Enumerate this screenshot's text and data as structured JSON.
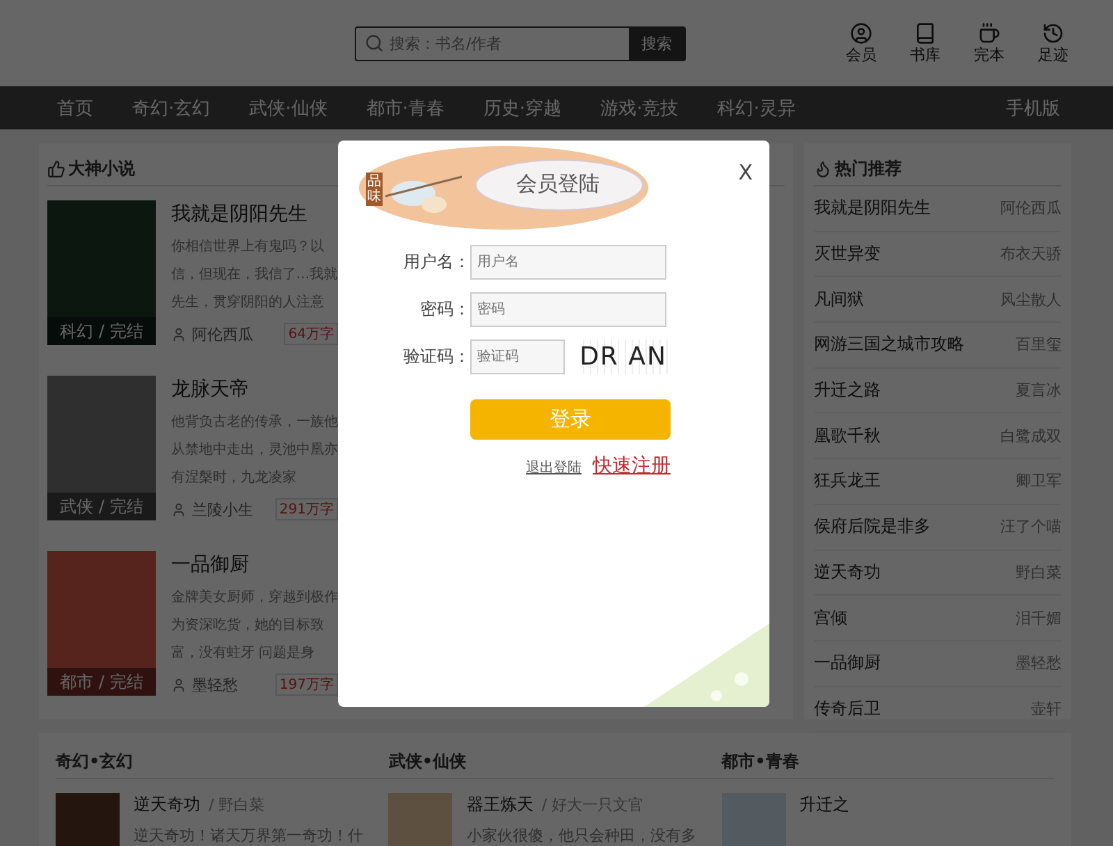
{
  "header": {
    "search": {
      "placeholder": "搜索：书名/作者",
      "button": "搜索"
    },
    "user_links": [
      {
        "kind": "member",
        "label": "会员"
      },
      {
        "kind": "library",
        "label": "书库"
      },
      {
        "kind": "finished",
        "label": "完本"
      },
      {
        "kind": "history",
        "label": "足迹"
      }
    ]
  },
  "nav": {
    "items": [
      "首页",
      "奇幻·玄幻",
      "武侠·仙侠",
      "都市·青春",
      "历史·穿越",
      "游戏·竞技",
      "科幻·灵异"
    ],
    "mobile": "手机版"
  },
  "featured": {
    "title": "大神小说",
    "books": [
      {
        "title": "我就是阴阳先生",
        "description": "你相信世界上有鬼吗？以信，但现在，我信了...我就先生，贯穿阴阳的人注意",
        "caption": "科幻 / 完结",
        "author": "阿伦西瓜",
        "words": "64万字"
      },
      {
        "title": "龙脉天帝",
        "description": "他背负古老的传承，一族他从禁地中走出，灵池中凰亦有涅槃时，九龙凌家",
        "caption": "武侠 / 完结",
        "author": "兰陵小生",
        "words": "291万字"
      },
      {
        "title": "一品御厨",
        "description": "金牌美女厨师，穿越到极作为资深吃货，她的目标致富，没有蛀牙 问题是身",
        "caption": "都市 / 完结",
        "author": "墨轻愁",
        "words": "197万字"
      }
    ]
  },
  "hot": {
    "title": "热门推荐",
    "items": [
      {
        "title": "我就是阴阳先生",
        "author": "阿伦西瓜"
      },
      {
        "title": "灭世异变",
        "author": "布衣天骄"
      },
      {
        "title": "凡间狱",
        "author": "风尘散人"
      },
      {
        "title": "网游三国之城市攻略",
        "author": "百里玺"
      },
      {
        "title": "升迁之路",
        "author": "夏言冰"
      },
      {
        "title": "凰歌千秋",
        "author": "白鹭成双"
      },
      {
        "title": "狂兵龙王",
        "author": "卿卫军"
      },
      {
        "title": "侯府后院是非多",
        "author": "汪了个喵"
      },
      {
        "title": "逆天奇功",
        "author": "野白菜"
      },
      {
        "title": "宫倾",
        "author": "泪千媚"
      },
      {
        "title": "一品御厨",
        "author": "墨轻愁"
      },
      {
        "title": "传奇后卫",
        "author": "壶轩"
      }
    ]
  },
  "categories": [
    {
      "title": "奇幻•玄幻",
      "book": {
        "title": "逆天奇功",
        "author": "/ 野白菜",
        "description": "逆天奇功！诸天万界第一奇功！什"
      }
    },
    {
      "title": "武侠•仙侠",
      "book": {
        "title": "器王炼天",
        "author": "/ 好大一只文官",
        "description": "小家伙很傻，他只会种田，没有多"
      }
    },
    {
      "title": "都市•青春",
      "book": {
        "title": "升迁之"
      }
    }
  ],
  "login": {
    "badge": "品味",
    "title": "会员登陆",
    "close": "X",
    "fields": [
      {
        "kind": "text",
        "label": "用户名：",
        "placeholder": "用户名"
      },
      {
        "kind": "password",
        "label": "密码：",
        "placeholder": "密码"
      },
      {
        "kind": "captcha",
        "label": "验证码：",
        "placeholder": "验证码",
        "captcha": "DR AN"
      }
    ],
    "submit": "登录",
    "logout": "退出登陆",
    "register": "快速注册"
  }
}
